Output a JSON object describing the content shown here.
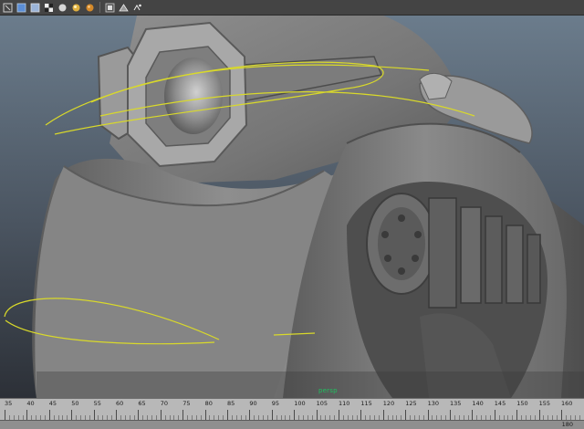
{
  "toolbar": {
    "icons": [
      "select-object-icon",
      "wireframe-shading-icon",
      "smooth-shade-icon",
      "textured-icon",
      "lighting-icon",
      "shadows-icon",
      "ambient-occlusion-icon",
      "isolate-select-icon",
      "xray-icon",
      "camera-attributes-icon"
    ]
  },
  "viewport": {
    "camera_name": "persp",
    "curve_color": "#d9d92a",
    "model_color": "#8a8a8a",
    "background_top": "#6b7c8c",
    "background_bottom": "#2c3037"
  },
  "timeline": {
    "labels": [
      "35",
      "40",
      "45",
      "50",
      "55",
      "60",
      "65",
      "70",
      "75",
      "80",
      "85",
      "90",
      "95",
      "100",
      "105",
      "110",
      "115",
      "120",
      "125",
      "130",
      "135",
      "140",
      "145",
      "150",
      "155",
      "160"
    ],
    "range_end": "180"
  }
}
